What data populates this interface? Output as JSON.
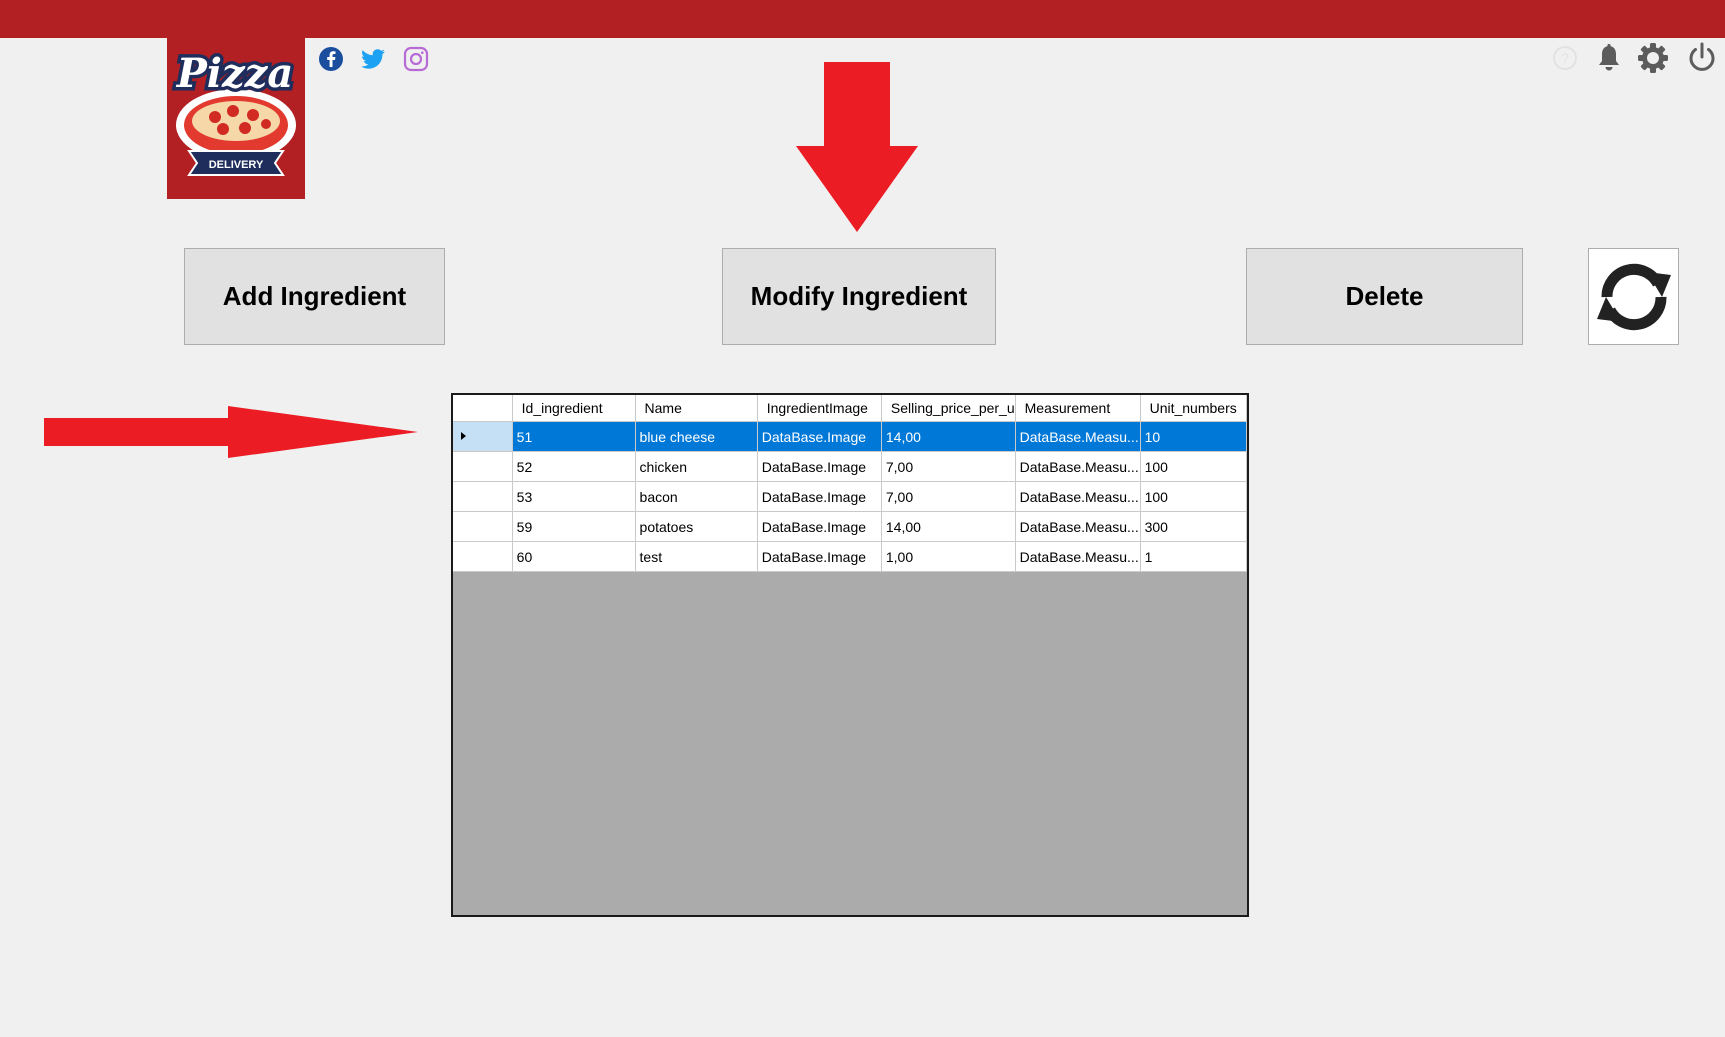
{
  "header": {
    "logo_title": "Pizza",
    "logo_subtitle": "DELIVERY",
    "social_icons": [
      "facebook-icon",
      "twitter-icon",
      "instagram-icon"
    ],
    "top_icons": [
      "help-icon",
      "bell-icon",
      "gear-icon",
      "power-icon"
    ]
  },
  "toolbar": {
    "add_label": "Add Ingredient",
    "modify_label": "Modify Ingredient",
    "delete_label": "Delete",
    "refresh_icon": "refresh-icon"
  },
  "grid": {
    "columns": [
      "Id_ingredient",
      "Name",
      "IngredientImage",
      "Selling_price_per_u",
      "Measurement",
      "Unit_numbers"
    ],
    "rows": [
      {
        "id": "51",
        "name": "blue cheese",
        "image": "DataBase.Image",
        "price": "14,00",
        "measurement": "DataBase.Measu...",
        "units": "10",
        "selected": true
      },
      {
        "id": "52",
        "name": "chicken",
        "image": "DataBase.Image",
        "price": "7,00",
        "measurement": "DataBase.Measu...",
        "units": "100",
        "selected": false
      },
      {
        "id": "53",
        "name": "bacon",
        "image": "DataBase.Image",
        "price": "7,00",
        "measurement": "DataBase.Measu...",
        "units": "100",
        "selected": false
      },
      {
        "id": "59",
        "name": "potatoes",
        "image": "DataBase.Image",
        "price": "14,00",
        "measurement": "DataBase.Measu...",
        "units": "300",
        "selected": false
      },
      {
        "id": "60",
        "name": "test",
        "image": "DataBase.Image",
        "price": "1,00",
        "measurement": "DataBase.Measu...",
        "units": "1",
        "selected": false
      }
    ]
  },
  "colors": {
    "brand_red": "#b22024",
    "annotation_arrow": "#ec1c24",
    "selection_blue": "#0078d7"
  }
}
